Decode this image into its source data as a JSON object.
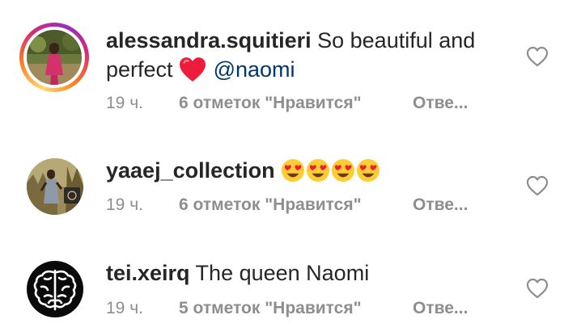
{
  "comments": [
    {
      "username": "alessandra.squitieri",
      "text_line1": " So beautiful and",
      "text_line2": "perfect ",
      "mention": "@naomi",
      "time": "19 ч.",
      "likes": "6 отметок \"Нравится\"",
      "reply": "Отве...",
      "has_story_ring": true,
      "emoji": [
        "red-heart"
      ]
    },
    {
      "username": "yaaej_collection",
      "text": " ",
      "time": "19 ч.",
      "likes": "6 отметок \"Нравится\"",
      "reply": "Отве...",
      "has_story_ring": false,
      "emoji": [
        "heart-eyes",
        "heart-eyes",
        "heart-eyes",
        "heart-eyes"
      ]
    },
    {
      "username": "tei.xeirq",
      "text": " The queen Naomi",
      "time": "19 ч.",
      "likes": "5 отметок \"Нравится\"",
      "reply": "Отве...",
      "has_story_ring": false
    }
  ],
  "colors": {
    "text": "#262626",
    "meta": "#8e8e8e",
    "mention": "#00376b",
    "heart_outline": "#8e8e8e",
    "emoji_heart": "#ed1c3a"
  }
}
